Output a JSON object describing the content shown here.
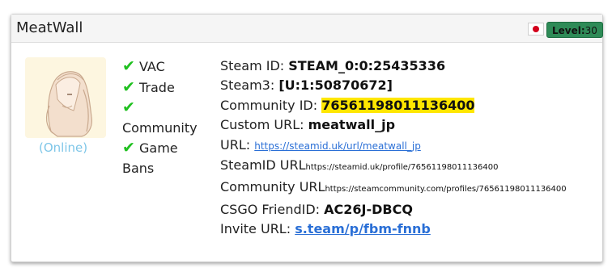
{
  "profile": {
    "name": "MeatWall",
    "country_flag": "japan-flag-icon",
    "level_label": "Level:",
    "level_value": "30",
    "status": "(Online)"
  },
  "checks": [
    {
      "label": "VAC"
    },
    {
      "label": "Trade"
    },
    {
      "label": "Community"
    },
    {
      "label": "Game Bans"
    }
  ],
  "details": {
    "steam_id_label": "Steam ID:",
    "steam_id": "STEAM_0:0:25435336",
    "steam3_label": "Steam3:",
    "steam3": "[U:1:50870672]",
    "community_id_label": "Community ID:",
    "community_id": "76561198011136400",
    "custom_url_label": "Custom URL:",
    "custom_url": "meatwall_jp",
    "url_label": "URL:",
    "url": "https://steamid.uk/url/meatwall_jp",
    "steamid_url_label": "SteamID URL",
    "steamid_url": "https://steamid.uk/profile/76561198011136400",
    "community_url_label": "Community URL",
    "community_url": "https://steamcommunity.com/profiles/76561198011136400",
    "csgo_label": "CSGO FriendID:",
    "csgo": "AC26J-DBCQ",
    "invite_label": "Invite URL:",
    "invite": "s.team/p/fbm-fnnb"
  },
  "colors": {
    "check_green": "#20c020",
    "highlight": "#ffe600",
    "link": "#2a6fd6",
    "level_badge": "#2e8b57",
    "online": "#7ec6e8"
  }
}
